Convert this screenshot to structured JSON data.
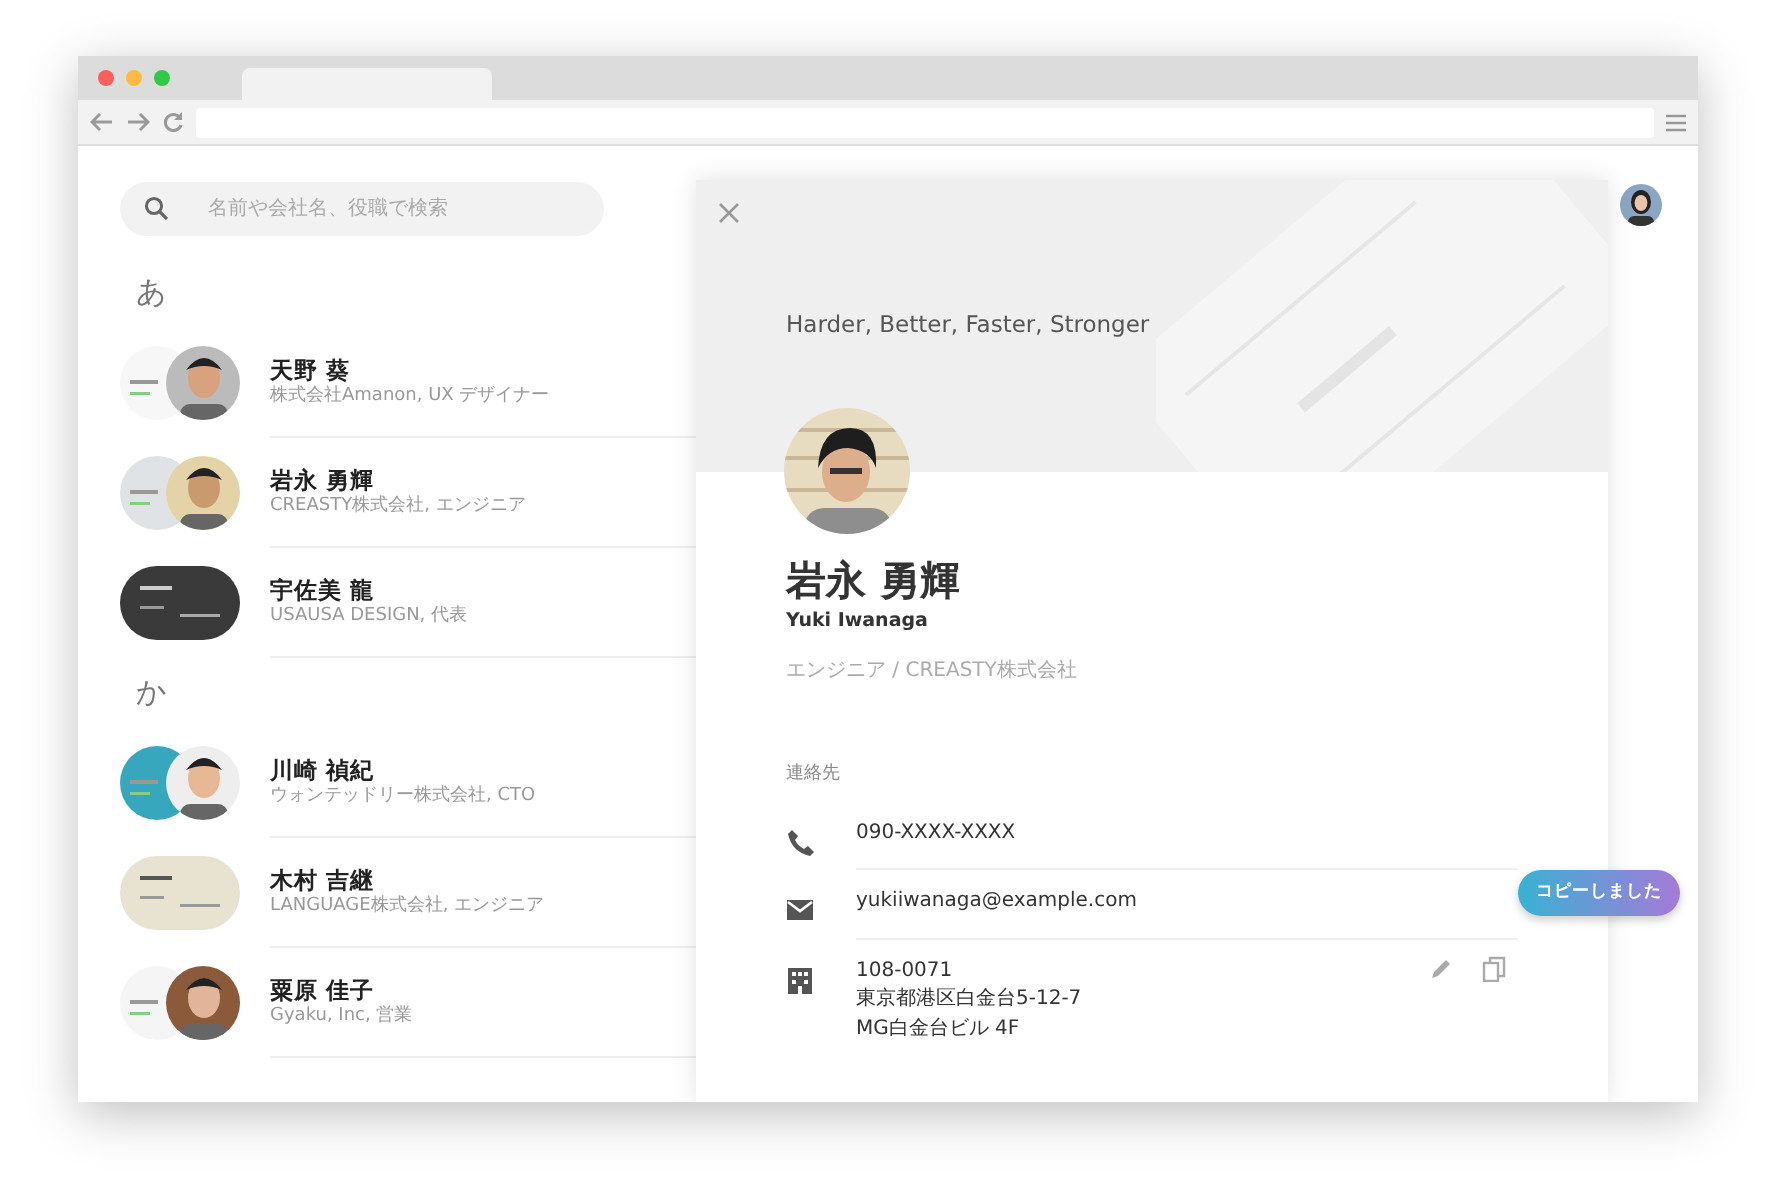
{
  "search": {
    "placeholder": "名前や会社名、役職で検索"
  },
  "sections": [
    {
      "letter": "あ",
      "contacts": [
        {
          "name": "天野 葵",
          "subtitle": "株式会社Amanon, UX デザイナー",
          "kind": "card_and_photo"
        },
        {
          "name": "岩永 勇輝",
          "subtitle": "CREASTY株式会社, エンジニア",
          "kind": "card_and_photo"
        },
        {
          "name": "宇佐美 龍",
          "subtitle": "USAUSA DESIGN, 代表",
          "kind": "card_only"
        }
      ]
    },
    {
      "letter": "か",
      "contacts": [
        {
          "name": "川崎 禎紀",
          "subtitle": "ウォンテッドリー株式会社, CTO",
          "kind": "card_and_photo"
        },
        {
          "name": "木村 吉継",
          "subtitle": "LANGUAGE株式会社, エンジニア",
          "kind": "card_only"
        },
        {
          "name": "粟原 佳子",
          "subtitle": "Gyaku, Inc, 営業",
          "kind": "card_and_photo"
        }
      ]
    }
  ],
  "detail": {
    "tagline": "Harder, Better, Faster, Stronger",
    "name": "岩永 勇輝",
    "name_romaji": "Yuki Iwanaga",
    "role": "エンジニア / CREASTY株式会社",
    "contact_heading": "連絡先",
    "contact_items": [
      {
        "kind": "phone",
        "lines": [
          "090-XXXX-XXXX"
        ]
      },
      {
        "kind": "email",
        "lines": [
          "yukiiwanaga@example.com"
        ]
      },
      {
        "kind": "address",
        "lines": [
          "108-0071",
          "東京都港区白金台5-12-7",
          "MG白金台ビル 4F"
        ],
        "actions": true
      }
    ],
    "toast": "コピーしました"
  }
}
